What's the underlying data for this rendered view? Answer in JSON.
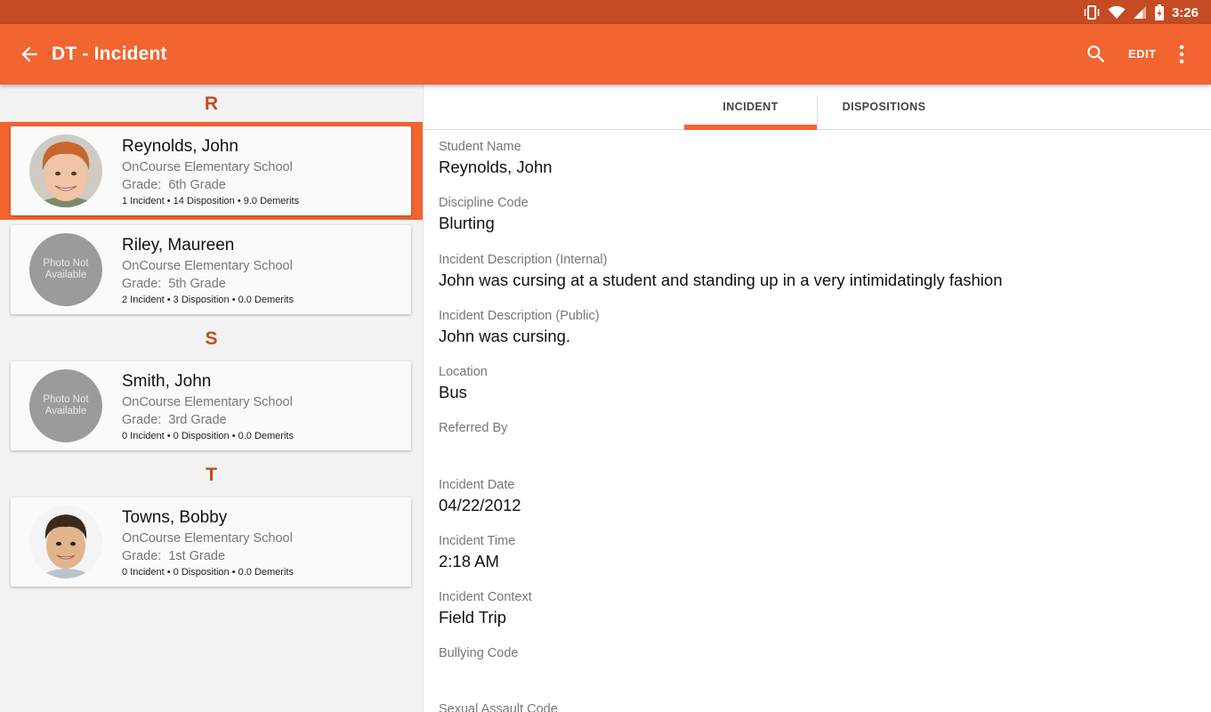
{
  "status_bar": {
    "time": "3:26"
  },
  "app_bar": {
    "title": "DT",
    "subtitle": "- Incident",
    "edit_label": "EDIT"
  },
  "sections": [
    "R",
    "S",
    "T"
  ],
  "students": [
    {
      "name": "Reynolds, John",
      "school": "OnCourse Elementary School",
      "grade_label": "Grade:",
      "grade": "6th Grade",
      "stats": "1 Incident • 14 Disposition • 9.0 Demerits",
      "photo": "photo",
      "selected": true
    },
    {
      "name": "Riley, Maureen",
      "school": "OnCourse Elementary School",
      "grade_label": "Grade:",
      "grade": "5th Grade",
      "stats": "2 Incident • 3 Disposition • 0.0 Demerits",
      "photo": "Photo Not Available",
      "selected": false
    },
    {
      "name": "Smith, John",
      "school": "OnCourse Elementary School",
      "grade_label": "Grade:",
      "grade": "3rd Grade",
      "stats": "0 Incident • 0 Disposition • 0.0 Demerits",
      "photo": "Photo Not Available",
      "selected": false
    },
    {
      "name": "Towns, Bobby",
      "school": "OnCourse Elementary School",
      "grade_label": "Grade:",
      "grade": "1st Grade",
      "stats": "0 Incident • 0 Disposition • 0.0 Demerits",
      "photo": "photo",
      "selected": false
    }
  ],
  "tabs": [
    {
      "label": "INCIDENT",
      "active": true
    },
    {
      "label": "DISPOSITIONS",
      "active": false
    }
  ],
  "fields": [
    {
      "label": "Student Name",
      "value": "Reynolds, John"
    },
    {
      "label": "Discipline Code",
      "value": "Blurting"
    },
    {
      "label": "Incident Description (Internal)",
      "value": "John was cursing at a student and standing up in a very intimidatingly fashion"
    },
    {
      "label": "Incident Description (Public)",
      "value": "John was cursing."
    },
    {
      "label": "Location",
      "value": "Bus"
    },
    {
      "label": "Referred By",
      "value": ""
    },
    {
      "label": "Incident Date",
      "value": "04/22/2012"
    },
    {
      "label": "Incident Time",
      "value": "2:18 AM"
    },
    {
      "label": "Incident Context",
      "value": "Field Trip"
    },
    {
      "label": "Bullying Code",
      "value": ""
    },
    {
      "label": "Sexual Assault Code",
      "value": ""
    }
  ],
  "colors": {
    "status_bar": "#c44b22",
    "app_bar": "#f26430",
    "section_letter": "#c44b22",
    "selected_band": "#f26430"
  },
  "icons": {
    "back": "arrow-back-icon",
    "search": "search-icon",
    "more": "more-vert-icon",
    "vibrate": "vibrate-icon",
    "wifi": "wifi-icon",
    "signal": "signal-icon",
    "battery": "battery-charging-icon"
  }
}
